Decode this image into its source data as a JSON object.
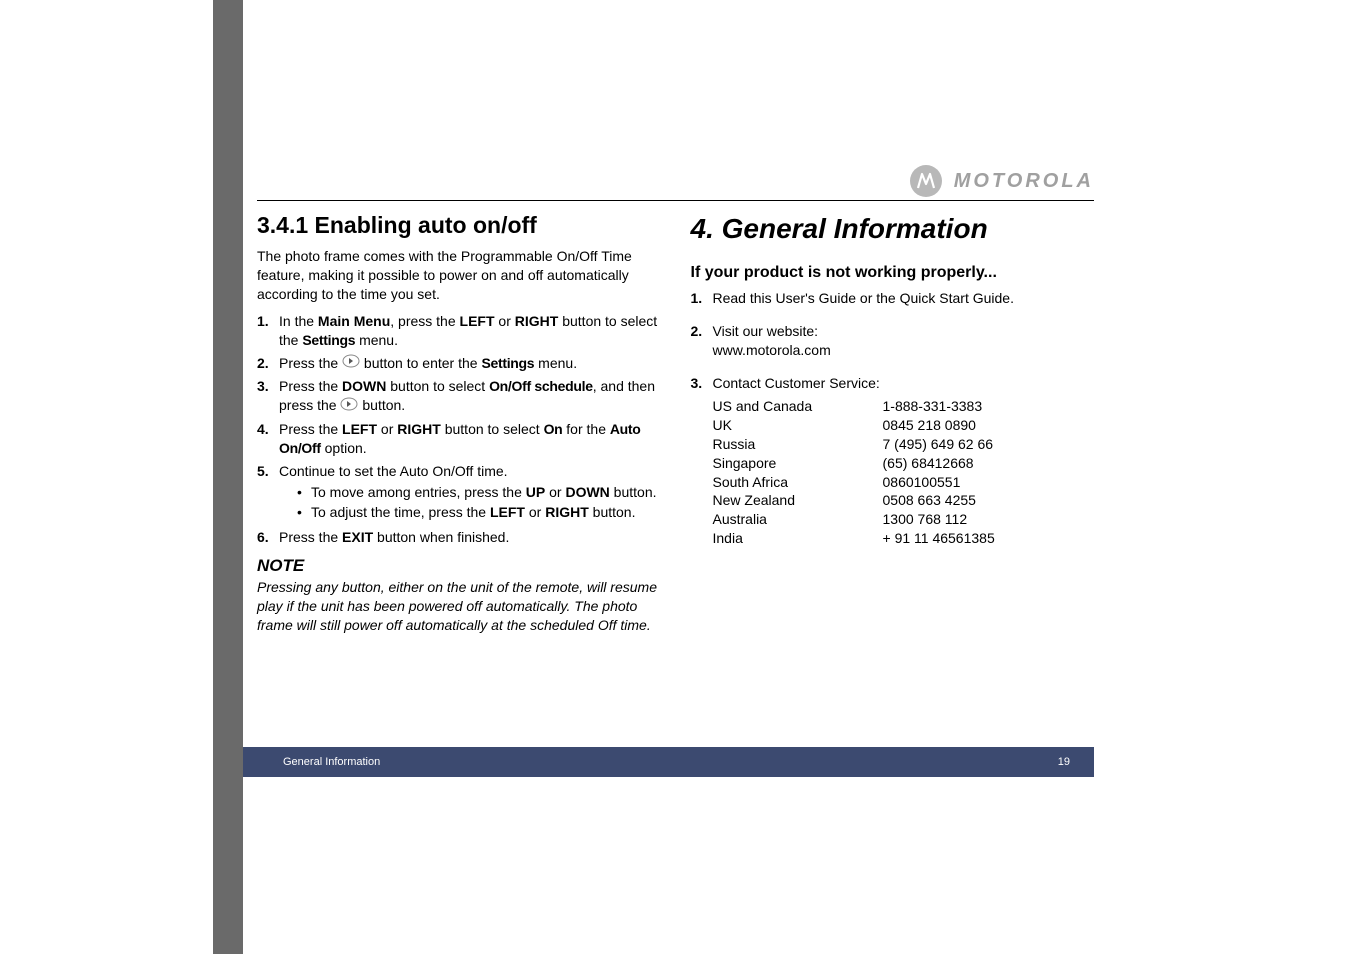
{
  "brand": "MOTOROLA",
  "left": {
    "heading": "3.4.1    Enabling auto on/off",
    "intro": "The photo frame comes with the Programmable On/Off Time feature, making it possible to power on and off automatically according to the time you set.",
    "step1_a": "In the ",
    "step1_b": "Main Menu",
    "step1_c": ", press the ",
    "step1_d": "LEFT",
    "step1_e": " or ",
    "step1_f": "RIGHT",
    "step1_g": " button to select the ",
    "step1_h": "Settings",
    "step1_i": " menu.",
    "step2_a": "Press the ",
    "step2_b": " button to enter the ",
    "step2_c": "Settings",
    "step2_d": " menu.",
    "step3_a": "Press the ",
    "step3_b": "DOWN",
    "step3_c": " button to select ",
    "step3_d": "On/Off schedule",
    "step3_e": ", and then press the ",
    "step3_f": " button.",
    "step4_a": "Press the ",
    "step4_b": "LEFT",
    "step4_c": " or ",
    "step4_d": "RIGHT",
    "step4_e": " button to select ",
    "step4_f": "On",
    "step4_g": " for the ",
    "step4_h": "Auto On/Off",
    "step4_i": " option.",
    "step5": "Continue to set the Auto On/Off time.",
    "step5_sub1_a": "To move among entries, press the ",
    "step5_sub1_b": "UP",
    "step5_sub1_c": " or ",
    "step5_sub1_d": "DOWN",
    "step5_sub1_e": " button.",
    "step5_sub2_a": "To adjust the time, press the ",
    "step5_sub2_b": "LEFT",
    "step5_sub2_c": " or ",
    "step5_sub2_d": "RIGHT",
    "step5_sub2_e": " button.",
    "step6_a": "Press the ",
    "step6_b": "EXIT",
    "step6_c": " button when finished.",
    "note_head": "NOTE",
    "note_body": "Pressing any button, either on the unit of the remote, will resume play if the unit has been powered off automatically. The photo frame will still power off automatically at the scheduled Off time."
  },
  "right": {
    "chapter": "4.  General Information",
    "subhead": "If your product is not working properly...",
    "step1": "Read this User's Guide or the Quick Start Guide.",
    "step2_a": "Visit our website:",
    "step2_b": "www.motorola.com",
    "step3": "Contact Customer Service:",
    "contacts": [
      {
        "region": "US and Canada",
        "number": "1-888-331-3383"
      },
      {
        "region": "UK",
        "number": "0845 218 0890"
      },
      {
        "region": "Russia",
        "number": "7 (495) 649 62 66"
      },
      {
        "region": "Singapore",
        "number": "(65) 68412668"
      },
      {
        "region": "South Africa",
        "number": "0860100551"
      },
      {
        "region": "New Zealand",
        "number": "0508 663 4255"
      },
      {
        "region": "Australia",
        "number": "1300 768 112"
      },
      {
        "region": "India",
        "number": "+ 91 11 46561385"
      }
    ]
  },
  "footer": {
    "section": "General Information",
    "page": "19"
  }
}
